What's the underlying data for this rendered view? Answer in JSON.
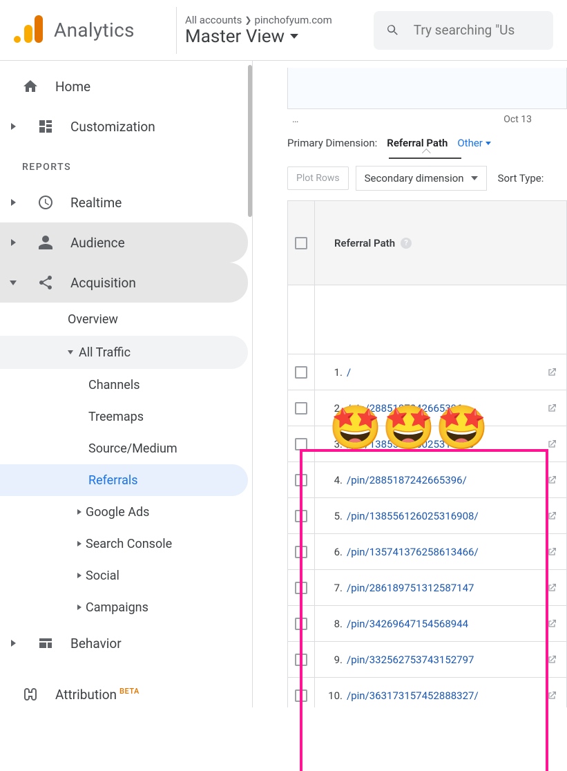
{
  "header": {
    "app_title": "Analytics",
    "breadcrumb_all": "All accounts",
    "breadcrumb_acct": "pinchofyum.com",
    "view_name": "Master View",
    "search_placeholder": "Try searching \"Us"
  },
  "sidebar": {
    "home": "Home",
    "customization": "Customization",
    "reports_header": "REPORTS",
    "realtime": "Realtime",
    "audience": "Audience",
    "acquisition": "Acquisition",
    "overview": "Overview",
    "all_traffic": "All Traffic",
    "channels": "Channels",
    "treemaps": "Treemaps",
    "source_medium": "Source/Medium",
    "referrals": "Referrals",
    "google_ads": "Google Ads",
    "search_console": "Search Console",
    "social": "Social",
    "campaigns": "Campaigns",
    "behavior": "Behavior",
    "attribution": "Attribution",
    "beta": "BETA"
  },
  "content": {
    "chart_dots": "…",
    "chart_date": "Oct 13",
    "primary_dim_label": "Primary Dimension:",
    "primary_dim_value": "Referral Path",
    "other_label": "Other",
    "plot_rows": "Plot Rows",
    "secondary_dim": "Secondary dimension",
    "sort_type": "Sort Type:",
    "th_referral_path": "Referral Path"
  },
  "rows": [
    {
      "n": "1.",
      "path": "/"
    },
    {
      "n": "2.",
      "path": "/pin/2885187242665396"
    },
    {
      "n": "3.",
      "path": "/pin/138556126025316908"
    },
    {
      "n": "4.",
      "path": "/pin/2885187242665396/"
    },
    {
      "n": "5.",
      "path": "/pin/138556126025316908/"
    },
    {
      "n": "6.",
      "path": "/pin/135741376258613466/"
    },
    {
      "n": "7.",
      "path": "/pin/286189751312587147"
    },
    {
      "n": "8.",
      "path": "/pin/34269647154568944"
    },
    {
      "n": "9.",
      "path": "/pin/332562753743152797"
    },
    {
      "n": "10.",
      "path": "/pin/363173157452888327/"
    }
  ]
}
